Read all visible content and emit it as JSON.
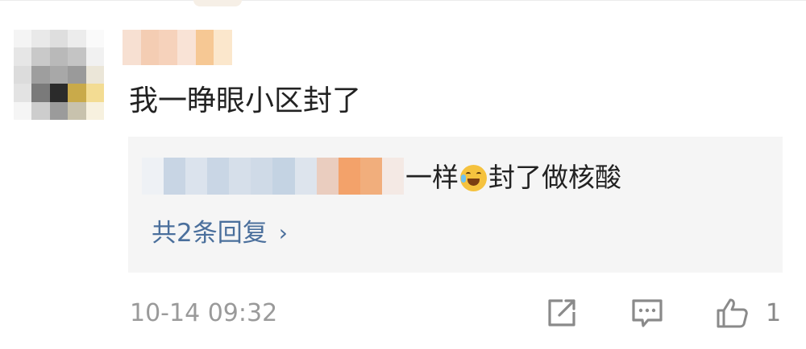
{
  "comment": {
    "text": "我一睁眼小区封了",
    "time": "10-14 09:32",
    "like_count": "1"
  },
  "reply": {
    "text_before_emoji": "一样",
    "text_after_emoji": "封了做核酸",
    "emoji": "laughing-crying-emoji"
  },
  "replies_link": {
    "label": "共2条回复",
    "chevron": "›"
  },
  "icons": [
    "share-icon",
    "comment-icon",
    "like-icon"
  ],
  "colors": {
    "link": "#4a6f9c",
    "meta": "#9a9a9a",
    "reply_bg": "#f5f5f5"
  }
}
